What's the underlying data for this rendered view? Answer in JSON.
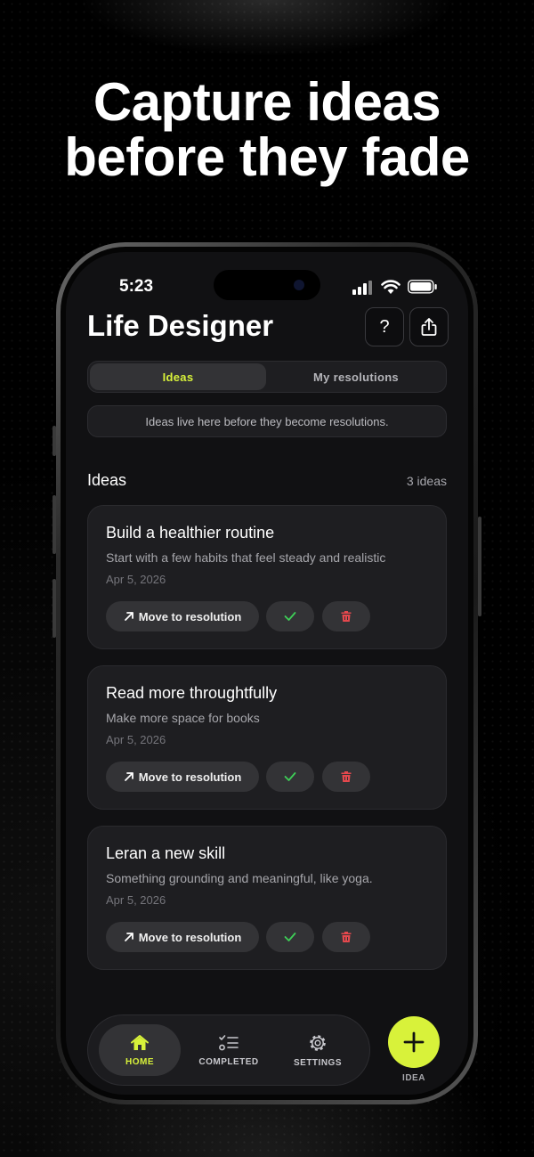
{
  "headline": {
    "line1": "Capture ideas",
    "line2": "before they fade"
  },
  "status": {
    "time": "5:23"
  },
  "header": {
    "title": "Life Designer",
    "help_icon": "question-mark-icon",
    "share_icon": "share-icon"
  },
  "segments": {
    "active": "Ideas",
    "other": "My resolutions"
  },
  "info_text": "Ideas live here before they become resolutions.",
  "section": {
    "title": "Ideas",
    "count": "3 ideas"
  },
  "cards": [
    {
      "title": "Build a healthier routine",
      "description": "Start with a few habits that feel steady and realistic",
      "date": "Apr 5, 2026",
      "move_label": "Move to resolution"
    },
    {
      "title": "Read more throughtfully",
      "description": "Make more space for books",
      "date": "Apr 5, 2026",
      "move_label": "Move to resolution"
    },
    {
      "title": "Leran a new skill",
      "description": "Something grounding and meaningful, like yoga.",
      "date": "Apr 5, 2026",
      "move_label": "Move to resolution"
    }
  ],
  "tabbar": {
    "home": "HOME",
    "completed": "COMPLETED",
    "settings": "SETTINGS"
  },
  "fab": {
    "label": "IDEA"
  },
  "colors": {
    "accent": "#d8f23a",
    "check": "#3ecf57",
    "delete": "#e5484d",
    "background": "#111113",
    "card": "#1e1e21"
  }
}
